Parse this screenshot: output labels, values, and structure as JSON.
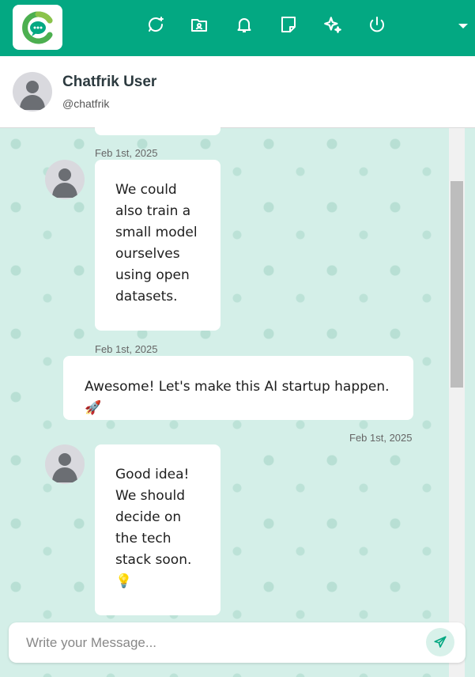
{
  "topbar": {
    "brand_color": "#03a882",
    "icons": [
      "new-chat-icon",
      "contacts-icon",
      "notifications-icon",
      "notes-icon",
      "ai-sparkle-icon",
      "power-icon"
    ]
  },
  "header": {
    "name": "Chatfrik User",
    "handle": "@chatfrik"
  },
  "messages": [
    {
      "side": "left",
      "date": "Feb 1st, 2025",
      "text": "We could also train a small model ourselves using open datasets."
    },
    {
      "side": "right",
      "date": "Feb 1st, 2025",
      "text": "Awesome! Let's make this AI startup happen. 🚀"
    },
    {
      "side": "left",
      "date": "Feb 1st, 2025",
      "text": "Good idea! We should decide on the tech stack soon. 💡"
    }
  ],
  "composer": {
    "placeholder": "Write your Message..."
  }
}
